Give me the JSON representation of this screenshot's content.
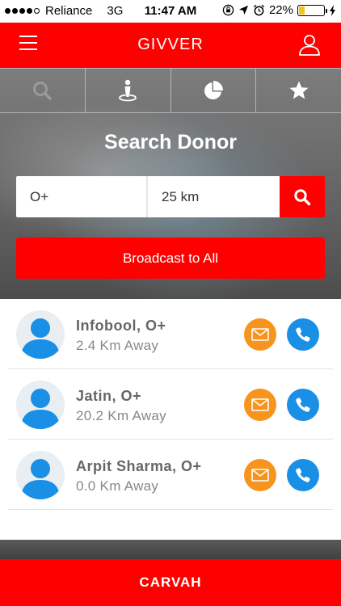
{
  "status_bar": {
    "carrier": "Reliance",
    "network": "3G",
    "time": "11:47 AM",
    "battery_percent": "22%",
    "battery_level": 0.22,
    "battery_color": "#f5c518"
  },
  "header": {
    "title": "GIVVER",
    "menu_icon": "hamburger-menu-icon",
    "profile_icon": "user-profile-icon"
  },
  "tabs": [
    {
      "icon": "search-icon",
      "active": false
    },
    {
      "icon": "map-pin-person-icon",
      "active": true
    },
    {
      "icon": "pie-chart-icon",
      "active": true
    },
    {
      "icon": "star-icon",
      "active": true
    }
  ],
  "search": {
    "title": "Search Donor",
    "blood_group_value": "O+",
    "distance_value": "25 km",
    "search_icon": "search-icon"
  },
  "broadcast": {
    "label": "Broadcast to All"
  },
  "donors": [
    {
      "name": "Infobool, O+",
      "distance": "2.4 Km Away"
    },
    {
      "name": "Jatin, O+",
      "distance": "20.2 Km Away"
    },
    {
      "name": "Arpit Sharma, O+",
      "distance": "0.0 Km Away"
    }
  ],
  "footer": {
    "label": "CARVAH"
  },
  "colors": {
    "brand": "#ff0000",
    "mail": "#f7941d",
    "call": "#1a8fe6",
    "avatar": "#1a8fe6"
  }
}
